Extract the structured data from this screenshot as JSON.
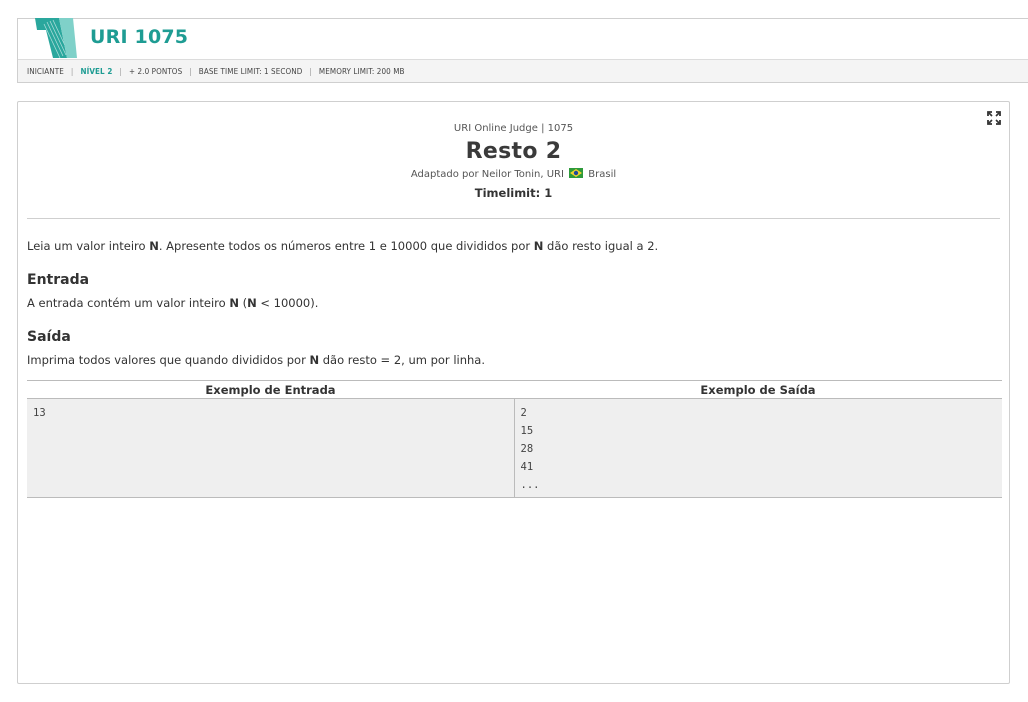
{
  "header": {
    "title": "URI 1075",
    "bar": [
      {
        "text": "INICIANTE",
        "accent": false
      },
      {
        "text": "NÍVEL 2",
        "accent": true
      },
      {
        "text": "+ 2.0 PONTOS",
        "accent": false
      },
      {
        "text": "BASE TIME LIMIT: 1 SECOND",
        "accent": false
      },
      {
        "text": "MEMORY LIMIT: 200 MB",
        "accent": false
      }
    ]
  },
  "problem": {
    "judge": "URI Online Judge | 1075",
    "title": "Resto 2",
    "author_prefix": "Adaptado por Neilor Tonin, URI",
    "country": "Brasil",
    "timelimit": "Timelimit: 1",
    "description": {
      "t1": "Leia um valor inteiro ",
      "b1": "N",
      "t2": ". Apresente todos os números entre 1 e 10000 que divididos por ",
      "b2": "N",
      "t3": " dão resto igual a 2."
    },
    "input_title": "Entrada",
    "input_text": {
      "t1": "A entrada contém um valor inteiro ",
      "b1": "N",
      "t2": " (",
      "b2": "N",
      "t3": " < 10000)."
    },
    "output_title": "Saída",
    "output_text": {
      "t1": "Imprima todos valores que quando divididos por ",
      "b1": "N",
      "t2": " dão resto = 2, um por linha."
    },
    "examples": {
      "input_header": "Exemplo de Entrada",
      "output_header": "Exemplo de Saída",
      "input_lines": [
        "13"
      ],
      "output_lines": [
        "2",
        "15",
        "28",
        "41",
        "..."
      ]
    }
  },
  "colors": {
    "accent": "#1e9c93",
    "flag_green": "#2e9a3b",
    "flag_yellow": "#f2d22e",
    "flag_blue": "#1f4a9c"
  },
  "icons": {
    "logo": "uri-logo-icon",
    "expand": "expand-icon",
    "flag": "brazil-flag-icon"
  }
}
